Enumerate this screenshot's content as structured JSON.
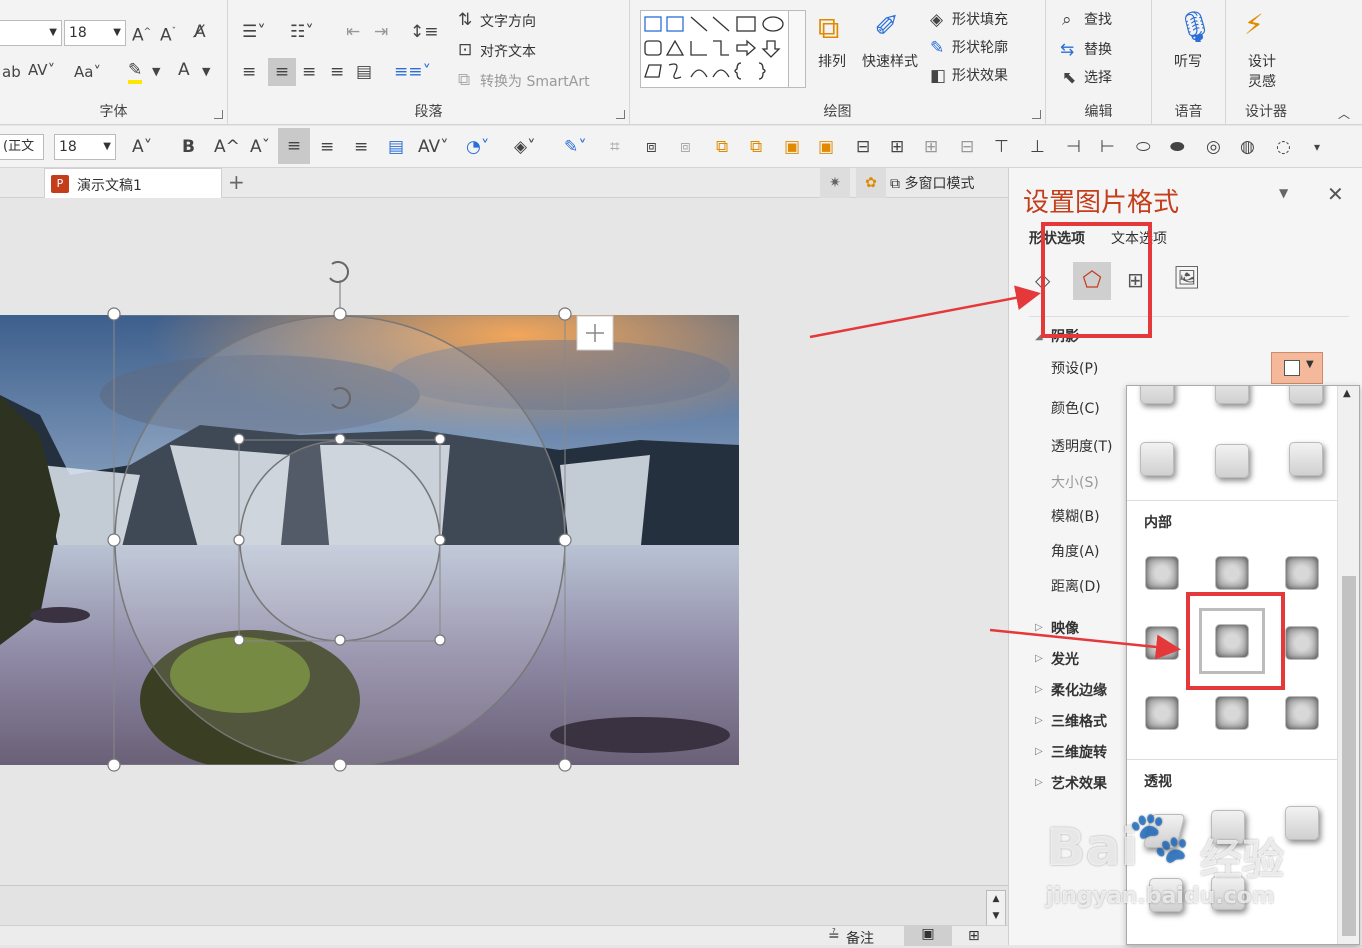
{
  "ribbon": {
    "font_group": {
      "label": "字体",
      "size": "18"
    },
    "paragraph_group": {
      "label": "段落",
      "text_direction": "文字方向",
      "align_text": "对齐文本",
      "smartart": "转换为 SmartArt"
    },
    "drawing_group": {
      "label": "绘图",
      "arrange": "排列",
      "quick_styles": "快速样式",
      "shape_fill": "形状填充",
      "shape_outline": "形状轮廓",
      "shape_effects": "形状效果"
    },
    "editing_group": {
      "label": "编辑",
      "find": "查找",
      "replace": "替换",
      "select": "选择"
    },
    "voice_group": {
      "label": "语音",
      "dictate": "听写"
    },
    "designer_group": {
      "label": "设计器",
      "design_ideas_line1": "设计",
      "design_ideas_line2": "灵感"
    }
  },
  "toolbar2": {
    "font": "(正文",
    "size": "18",
    "bold": "B"
  },
  "tabs": {
    "doc_title": "演示文稿1",
    "add": "+",
    "multi_window": "多窗口模式"
  },
  "pane": {
    "title": "设置图片格式",
    "tab_shape": "形状选项",
    "tab_text": "文本选项",
    "section_shadow": "阴影",
    "preset": "预设(P)",
    "color": "颜色(C)",
    "transparency": "透明度(T)",
    "size": "大小(S)",
    "blur": "模糊(B)",
    "angle": "角度(A)",
    "distance": "距离(D)",
    "sections": [
      "映像",
      "发光",
      "柔化边缘",
      "三维格式",
      "三维旋转",
      "艺术效果"
    ]
  },
  "gallery": {
    "inner_label": "内部",
    "perspective_label": "透视"
  },
  "statusbar": {
    "notes": "备注"
  },
  "watermark": {
    "brand": "Bai",
    "brand_cn": "经验",
    "url": "jingyan.baidu.com"
  },
  "colors": {
    "accent": "#c43e1c",
    "annotation": "#e5383b"
  }
}
